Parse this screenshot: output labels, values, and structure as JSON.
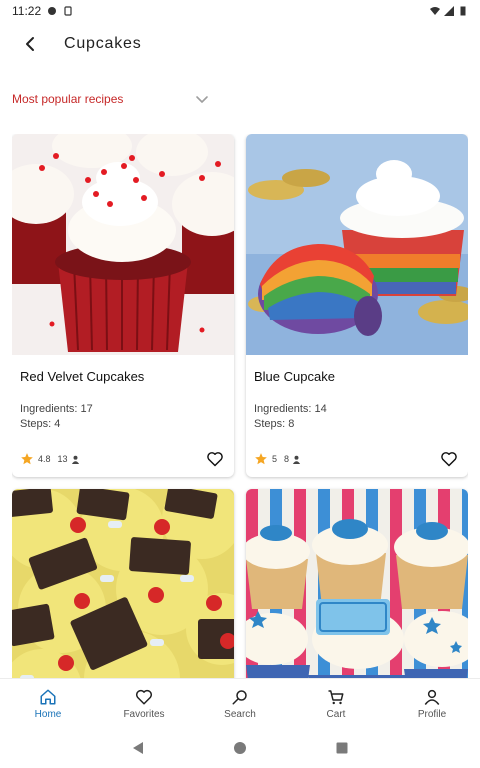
{
  "status_bar": {
    "time": "11:22"
  },
  "app_bar": {
    "title": "Cupcakes",
    "back_icon": "arrow-back-icon"
  },
  "sort": {
    "selected": "Most popular recipes",
    "accent_color": "#c62828"
  },
  "recipes": [
    {
      "title": "Red Velvet Cupcakes",
      "ingredients": "Ingredients: 17",
      "steps": "Steps: 4",
      "rating": "4.8",
      "count": "13"
    },
    {
      "title": "Blue Cupcake",
      "ingredients": "Ingredients: 14",
      "steps": "Steps: 8",
      "rating": "5",
      "count": "8"
    },
    {
      "title": "",
      "ingredients": "",
      "steps": "",
      "rating": "",
      "count": ""
    },
    {
      "title": "",
      "ingredients": "",
      "steps": "",
      "rating": "",
      "count": ""
    }
  ],
  "bottom_nav": [
    {
      "label": "Home",
      "icon": "home-icon",
      "active": true
    },
    {
      "label": "Favorites",
      "icon": "heart-icon",
      "active": false
    },
    {
      "label": "Search",
      "icon": "search-icon",
      "active": false
    },
    {
      "label": "Cart",
      "icon": "cart-icon",
      "active": false
    },
    {
      "label": "Profile",
      "icon": "person-icon",
      "active": false
    }
  ],
  "colors": {
    "active_nav": "#1a73b8",
    "star": "#f5a623"
  }
}
